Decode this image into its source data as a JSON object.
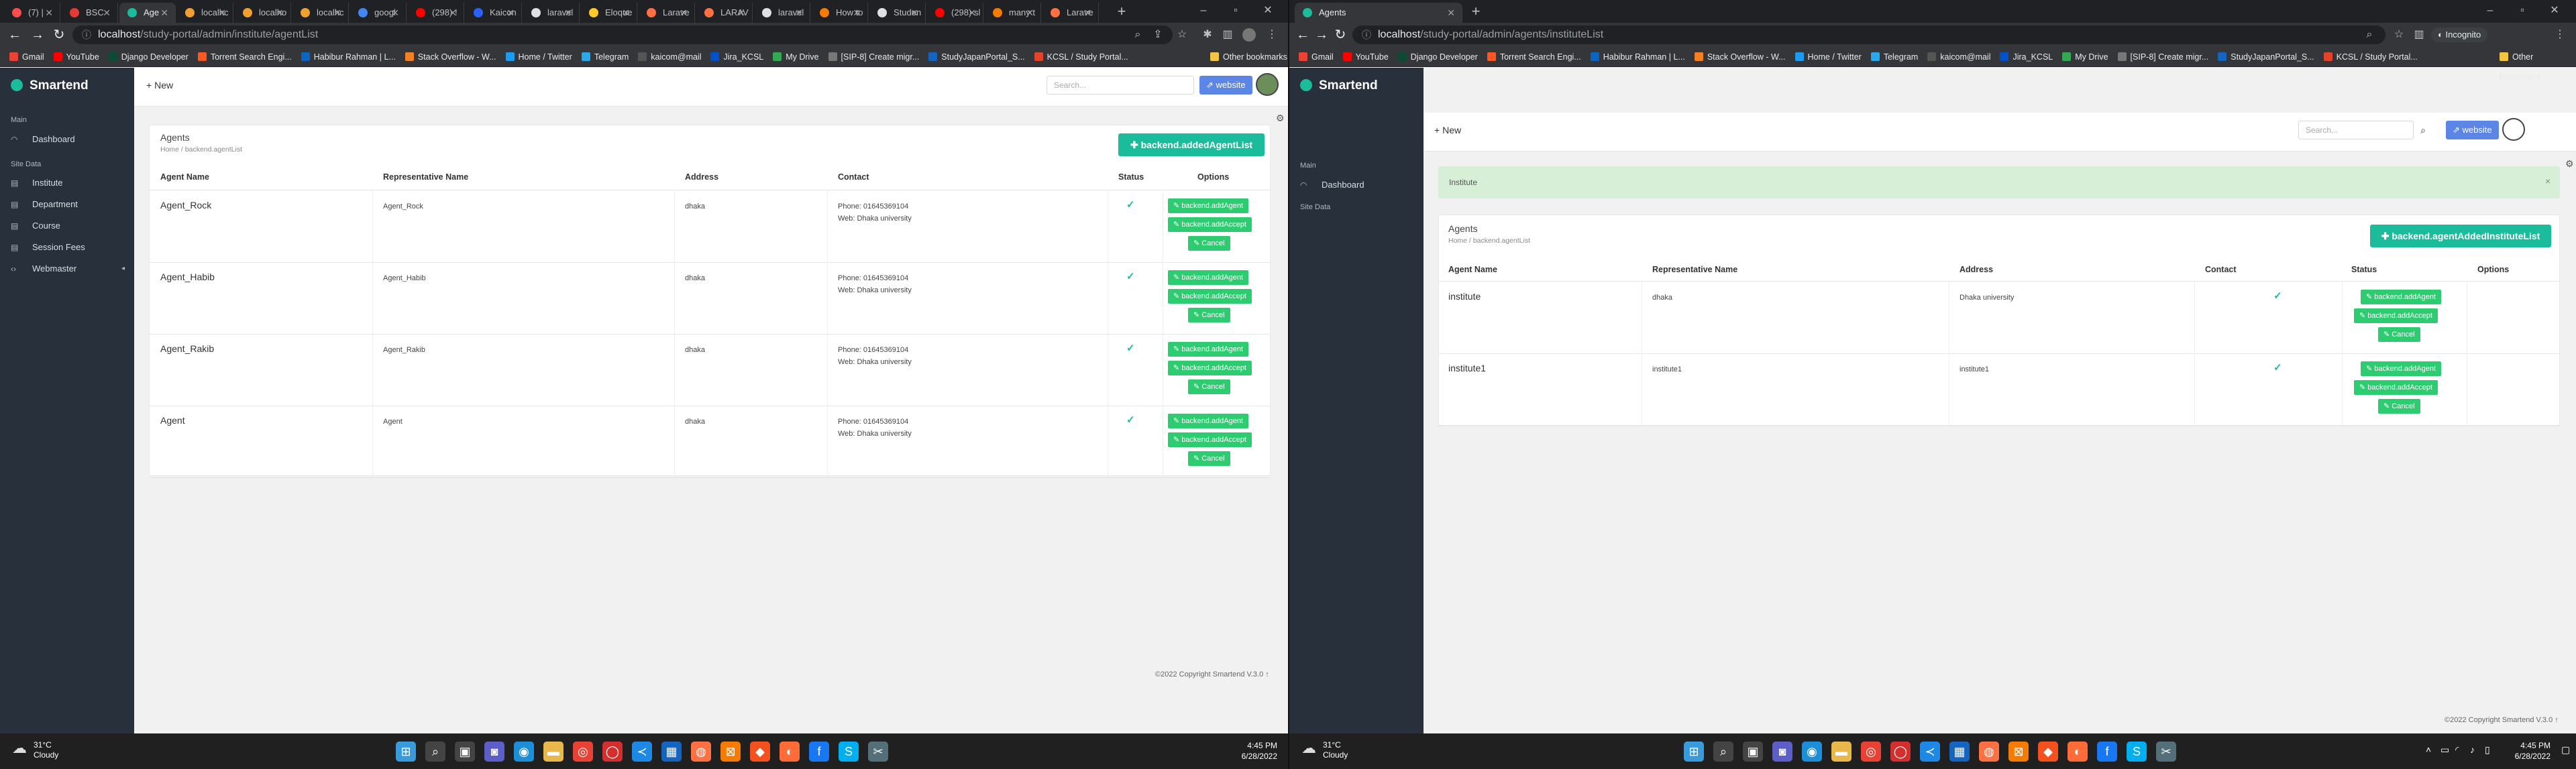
{
  "left_window": {
    "tabs": [
      "(7) |",
      "BSC",
      "Age",
      "localhc",
      "localho",
      "localhc",
      "googl",
      "(298) !",
      "Kaicon",
      "laravel",
      "Eloque",
      "Larave",
      "LARAV",
      "laravel",
      "How to",
      "Studen",
      "(298) sl",
      "many t",
      "Larave"
    ],
    "active_tab_index": 2,
    "url_host": "localhost",
    "url_path": "/study-portal/admin/institute/agentList",
    "bookmarks": [
      "Gmail",
      "YouTube",
      "Django Developer",
      "Torrent Search Engi...",
      "Habibur Rahman | L...",
      "Stack Overflow - W...",
      "Home / Twitter",
      "Telegram",
      "kaicom@mail",
      "Jira_KCSL",
      "My Drive",
      "[SIP-8] Create migr...",
      "StudyJapanPortal_S...",
      "KCSL / Study Portal..."
    ],
    "other_bookmarks": "Other bookmarks",
    "brand": "Smartend",
    "sidebar": {
      "main_label": "Main",
      "dashboard": "Dashboard",
      "site_data_label": "Site Data",
      "items": [
        "Institute",
        "Department",
        "Course",
        "Session Fees",
        "Webmaster"
      ]
    },
    "new_label": "New",
    "search_placeholder": "Search...",
    "website_label": "website",
    "page_title": "Agents",
    "breadcrumb": "Home / backend.agentList",
    "add_button": "backend.addedAgentList",
    "columns": [
      "Agent Name",
      "Representative Name",
      "Address",
      "Contact",
      "Status",
      "Options"
    ],
    "rows": [
      {
        "name": "Agent_Rock",
        "rep": "Agent_Rock",
        "address": "dhaka",
        "phone": "Phone: 01645369104",
        "web": "Web: Dhaka university",
        "status": "✓"
      },
      {
        "name": "Agent_Habib",
        "rep": "Agent_Habib",
        "address": "dhaka",
        "phone": "Phone: 01645369104",
        "web": "Web: Dhaka university",
        "status": "✓"
      },
      {
        "name": "Agent_Rakib",
        "rep": "Agent_Rakib",
        "address": "dhaka",
        "phone": "Phone: 01645369104",
        "web": "Web: Dhaka university",
        "status": "✓"
      },
      {
        "name": "Agent",
        "rep": "Agent",
        "address": "dhaka",
        "phone": "Phone: 01645369104",
        "web": "Web: Dhaka university",
        "status": "✓"
      }
    ],
    "row_buttons": [
      "backend.addAgent",
      "backend.addAccept",
      "Cancel"
    ],
    "footer": "©2022 Copyright Smartend V.3.0",
    "weather_temp": "31°C",
    "weather_text": "Cloudy",
    "time": "4:45 PM",
    "date": "6/28/2022"
  },
  "right_window": {
    "tab": "Agents",
    "url_host": "localhost",
    "url_path": "/study-portal/admin/agents/instituteList",
    "profile": "Incognito",
    "bookmarks": [
      "Gmail",
      "YouTube",
      "Django Developer",
      "Torrent Search Engi...",
      "Habibur Rahman | L...",
      "Stack Overflow - W...",
      "Home / Twitter",
      "Telegram",
      "kaicom@mail",
      "Jira_KCSL",
      "My Drive",
      "[SIP-8] Create migr...",
      "StudyJapanPortal_S...",
      "KCSL / Study Portal..."
    ],
    "other_bookmarks": "Other bookmarks",
    "brand": "Smartend",
    "sidebar": {
      "main_label": "Main",
      "dashboard": "Dashboard",
      "site_data_label": "Site Data"
    },
    "new_label": "New",
    "search_placeholder": "Search...",
    "website_label": "website",
    "alert_text": "Institute",
    "page_title": "Agents",
    "breadcrumb": "Home / backend.agentList",
    "add_button": "backend.agentAddedInstituteList",
    "columns": [
      "Agent Name",
      "Representative Name",
      "Address",
      "Contact",
      "Status",
      "Options"
    ],
    "rows": [
      {
        "name": "institute",
        "rep": "dhaka",
        "address": "Dhaka university",
        "status": "✓"
      },
      {
        "name": "institute1",
        "rep": "institute1",
        "address": "institute1",
        "status": "✓"
      }
    ],
    "row_buttons": [
      "backend.addAgent",
      "backend.addAccept",
      "Cancel"
    ],
    "footer": "©2022 Copyright Smartend V.3.0",
    "weather_temp": "31°C",
    "weather_text": "Cloudy",
    "time": "4:45 PM",
    "date": "6/28/2022"
  },
  "colors": {
    "sidebar": "#28313b",
    "accent_teal": "#1abc9c",
    "button_green": "#2ecc71",
    "website_blue": "#5b86e5",
    "chrome_dark": "#202124"
  }
}
